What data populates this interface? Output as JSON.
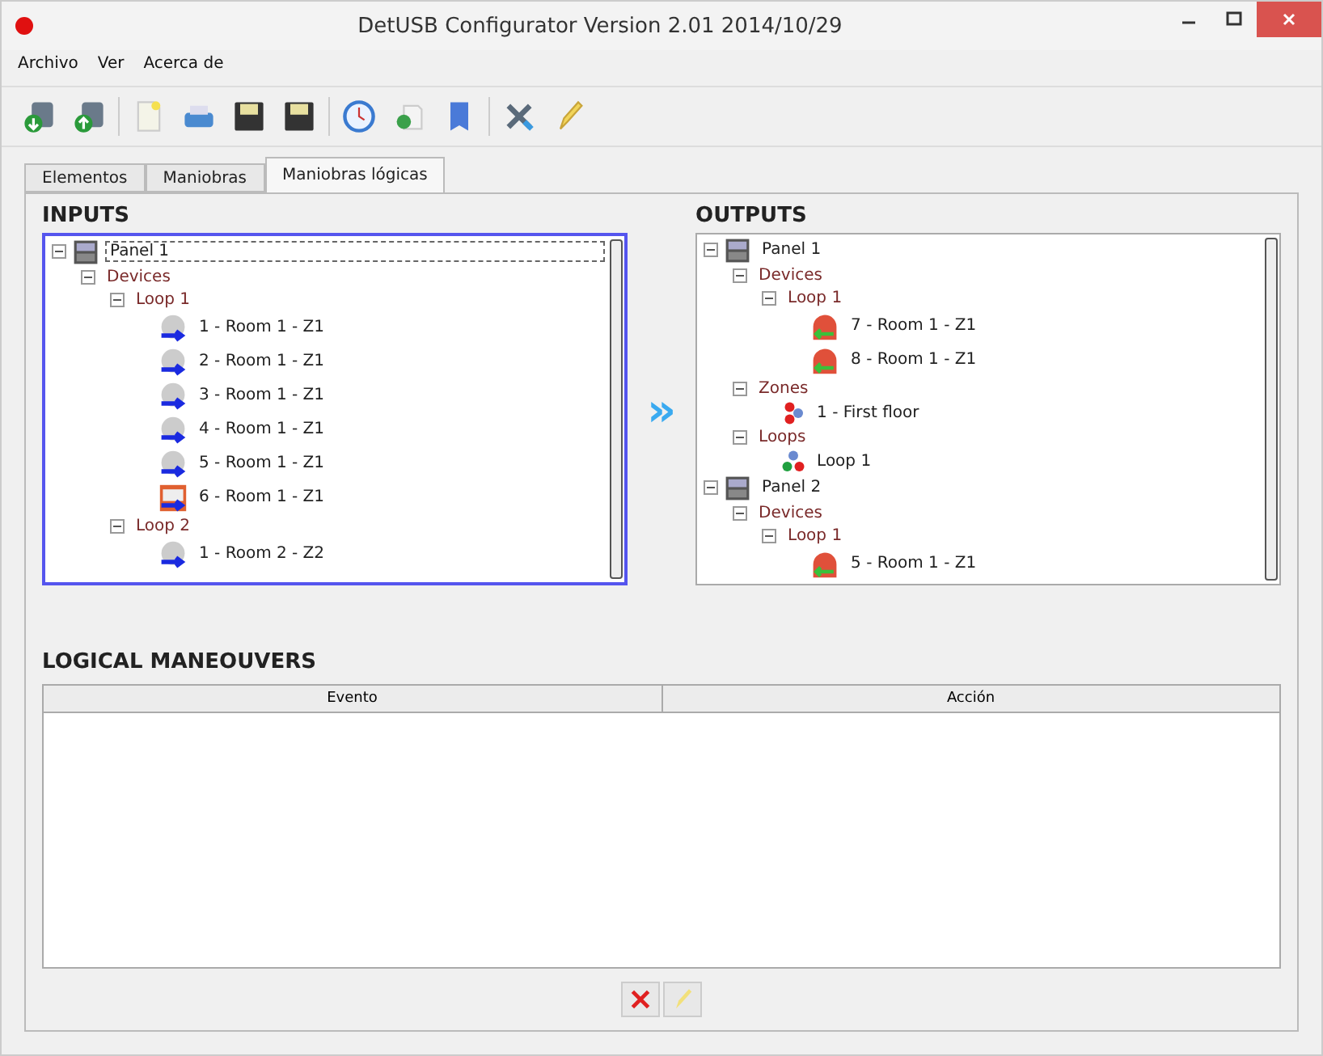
{
  "window": {
    "title": "DetUSB Configurator Version 2.01 2014/10/29"
  },
  "menu": [
    "Archivo",
    "Ver",
    "Acerca de"
  ],
  "toolbar": [
    {
      "kind": "download"
    },
    {
      "kind": "upload"
    },
    {
      "kind": "separator"
    },
    {
      "kind": "new"
    },
    {
      "kind": "print"
    },
    {
      "kind": "save"
    },
    {
      "kind": "save"
    },
    {
      "kind": "separator"
    },
    {
      "kind": "clock"
    },
    {
      "kind": "add"
    },
    {
      "kind": "book"
    },
    {
      "kind": "separator"
    },
    {
      "kind": "tools"
    },
    {
      "kind": "pencil"
    }
  ],
  "tabs": [
    {
      "label": "Elementos",
      "selected": false
    },
    {
      "label": "Maniobras",
      "selected": false
    },
    {
      "label": "Maniobras lógicas",
      "selected": true
    }
  ],
  "inputs": {
    "title": "INPUTS",
    "focused": true,
    "tree": [
      {
        "kind": "panel",
        "label": "Panel 1",
        "selected": true,
        "expanded": true,
        "children": [
          {
            "kind": "folder",
            "label": "Devices",
            "selected": false,
            "expanded": true,
            "children": [
              {
                "kind": "folder",
                "label": "Loop 1",
                "selected": false,
                "expanded": true,
                "children": [
                  {
                    "kind": "detector",
                    "label": "1 - Room 1 - Z1",
                    "selected": false
                  },
                  {
                    "kind": "detector",
                    "label": "2 - Room 1 - Z1",
                    "selected": false
                  },
                  {
                    "kind": "detector",
                    "label": "3 - Room 1 - Z1",
                    "selected": false
                  },
                  {
                    "kind": "detector",
                    "label": "4 - Room 1 - Z1",
                    "selected": false
                  },
                  {
                    "kind": "detector",
                    "label": "5 - Room 1 - Z1",
                    "selected": false
                  },
                  {
                    "kind": "callpoint",
                    "label": "6 - Room 1 - Z1",
                    "selected": false
                  }
                ]
              },
              {
                "kind": "folder",
                "label": "Loop 2",
                "selected": false,
                "expanded": true,
                "children": [
                  {
                    "kind": "detector",
                    "label": "1 - Room 2 - Z2",
                    "selected": false
                  }
                ]
              }
            ]
          }
        ]
      }
    ]
  },
  "arrow": "»",
  "outputs": {
    "title": "OUTPUTS",
    "focused": false,
    "tree": [
      {
        "kind": "panel",
        "label": "Panel 1",
        "selected": false,
        "expanded": true,
        "children": [
          {
            "kind": "folder",
            "label": "Devices",
            "selected": false,
            "expanded": true,
            "children": [
              {
                "kind": "folder",
                "label": "Loop 1",
                "selected": false,
                "expanded": true,
                "children": [
                  {
                    "kind": "sounder",
                    "label": "7 - Room 1 - Z1",
                    "selected": false
                  },
                  {
                    "kind": "sounder",
                    "label": "8 - Room 1 - Z1",
                    "selected": false
                  }
                ]
              }
            ]
          },
          {
            "kind": "folder",
            "label": "Zones",
            "selected": false,
            "expanded": true,
            "children": [
              {
                "kind": "zone",
                "label": "1 - First floor",
                "selected": false
              }
            ]
          },
          {
            "kind": "folder",
            "label": "Loops",
            "selected": false,
            "expanded": true,
            "children": [
              {
                "kind": "loop",
                "label": "Loop 1",
                "selected": false
              }
            ]
          }
        ]
      },
      {
        "kind": "panel",
        "label": "Panel 2",
        "selected": false,
        "expanded": true,
        "children": [
          {
            "kind": "folder",
            "label": "Devices",
            "selected": false,
            "expanded": true,
            "children": [
              {
                "kind": "folder",
                "label": "Loop 1",
                "selected": false,
                "expanded": true,
                "children": [
                  {
                    "kind": "sounder",
                    "label": "5 - Room 1 - Z1",
                    "selected": false
                  }
                ]
              }
            ]
          }
        ]
      }
    ]
  },
  "logical": {
    "title": "LOGICAL MANEOUVERS",
    "columns": [
      "Evento",
      "Acción"
    ]
  },
  "actions": [
    {
      "kind": "delete"
    },
    {
      "kind": "edit"
    }
  ]
}
